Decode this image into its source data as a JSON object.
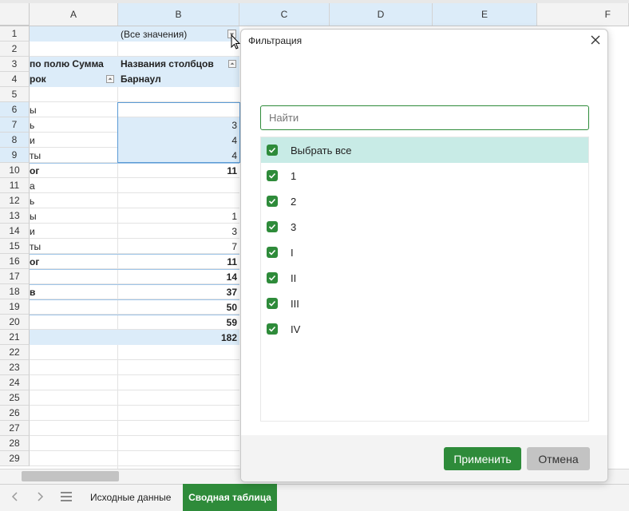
{
  "columns": [
    "A",
    "B",
    "C",
    "D",
    "E",
    "F"
  ],
  "rows": [
    "1",
    "2",
    "3",
    "4",
    "5",
    "6",
    "7",
    "8",
    "9",
    "10",
    "11",
    "12",
    "13",
    "14",
    "15",
    "16",
    "17",
    "18",
    "19",
    "20",
    "21",
    "22",
    "23",
    "24",
    "25",
    "26",
    "27",
    "28",
    "29"
  ],
  "pivot": {
    "b1": "(Все значения)",
    "a3": "по полю Сумма",
    "a4": "рок",
    "b3": "Названия столбцов",
    "b4": "Барнаул",
    "a6": "ы",
    "a7": "ь",
    "b7": "3",
    "a8": "и",
    "b8": "4",
    "a9": "ты",
    "b9": "4",
    "a10": "ог",
    "b10": "11",
    "a11": "а",
    "a12": "ь",
    "a13": "ы",
    "b13": "1",
    "a14": "и",
    "b14": "3",
    "a15": "ты",
    "b15": "7",
    "a16": "ог",
    "b16": "11",
    "b17": "14",
    "a18": "в",
    "b18": "37",
    "b19": "50",
    "b20": "59",
    "b21": "182"
  },
  "dialog": {
    "title": "Фильтрация",
    "search_placeholder": "Найти",
    "select_all": "Выбрать все",
    "items": [
      "1",
      "2",
      "3",
      "I",
      "II",
      "III",
      "IV"
    ],
    "apply": "Применить",
    "cancel": "Отмена"
  },
  "sheets": {
    "tab1": "Исходные данные",
    "tab2": "Сводная таблица"
  },
  "colors": {
    "accent": "#2e8b3a",
    "selection": "#dcecf9"
  }
}
